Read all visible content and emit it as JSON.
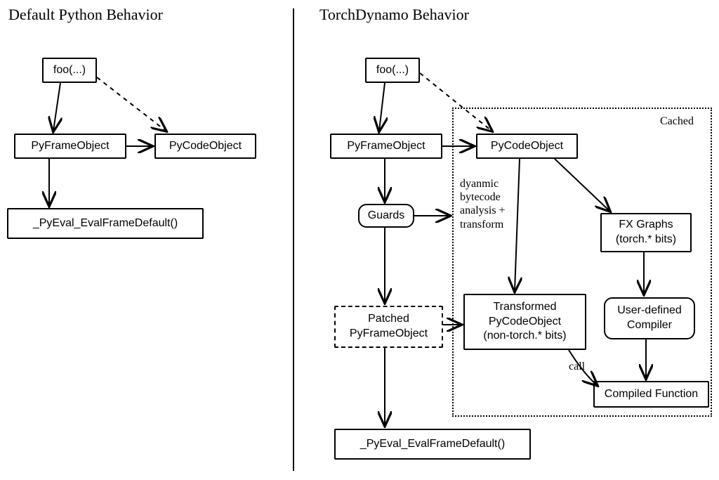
{
  "left": {
    "title": "Default Python Behavior",
    "foo": "foo(...)",
    "pyframe": "PyFrameObject",
    "pycode": "PyCodeObject",
    "eval": "_PyEval_EvalFrameDefault()"
  },
  "right": {
    "title": "TorchDynamo Behavior",
    "foo": "foo(...)",
    "pyframe": "PyFrameObject",
    "pycode": "PyCodeObject",
    "guards": "Guards",
    "patched": "Patched\nPyFrameObject",
    "transformed": "Transformed\nPyCodeObject\n(non-torch.* bits)",
    "fx": "FX Graphs\n(torch.* bits)",
    "udc": "User-defined\nCompiler",
    "compiled": "Compiled Function",
    "eval": "_PyEval_EvalFrameDefault()",
    "cached": "Cached",
    "dyn": "dyanmic\nbytecode\nanalysis +\ntransform",
    "call": "call"
  },
  "chart_data": {
    "type": "flowchart",
    "panels": [
      {
        "title": "Default Python Behavior",
        "nodes": [
          {
            "id": "foo",
            "label": "foo(...)"
          },
          {
            "id": "pyframe",
            "label": "PyFrameObject"
          },
          {
            "id": "pycode",
            "label": "PyCodeObject"
          },
          {
            "id": "eval",
            "label": "_PyEval_EvalFrameDefault()"
          }
        ],
        "edges": [
          {
            "from": "foo",
            "to": "pyframe",
            "style": "solid"
          },
          {
            "from": "foo",
            "to": "pycode",
            "style": "dashed"
          },
          {
            "from": "pyframe",
            "to": "pycode",
            "style": "solid"
          },
          {
            "from": "pyframe",
            "to": "eval",
            "style": "solid"
          }
        ]
      },
      {
        "title": "TorchDynamo Behavior",
        "cached_region": [
          "pycode",
          "transformed",
          "fx",
          "udc",
          "compiled"
        ],
        "nodes": [
          {
            "id": "foo",
            "label": "foo(...)"
          },
          {
            "id": "pyframe",
            "label": "PyFrameObject"
          },
          {
            "id": "pycode",
            "label": "PyCodeObject"
          },
          {
            "id": "guards",
            "label": "Guards",
            "shape": "rounded"
          },
          {
            "id": "patched",
            "label": "Patched PyFrameObject",
            "style": "dashed"
          },
          {
            "id": "transformed",
            "label": "Transformed PyCodeObject (non-torch.* bits)"
          },
          {
            "id": "fx",
            "label": "FX Graphs (torch.* bits)"
          },
          {
            "id": "udc",
            "label": "User-defined Compiler",
            "shape": "rounded"
          },
          {
            "id": "compiled",
            "label": "Compiled Function"
          },
          {
            "id": "eval",
            "label": "_PyEval_EvalFrameDefault()"
          }
        ],
        "edges": [
          {
            "from": "foo",
            "to": "pyframe",
            "style": "solid"
          },
          {
            "from": "foo",
            "to": "pycode",
            "style": "dashed"
          },
          {
            "from": "pyframe",
            "to": "pycode",
            "style": "solid"
          },
          {
            "from": "pyframe",
            "to": "guards",
            "style": "solid"
          },
          {
            "from": "guards",
            "to": "patched",
            "style": "solid"
          },
          {
            "from": "guards",
            "to": "transformed",
            "style": "solid",
            "note": "dyanmic bytecode analysis + transform"
          },
          {
            "from": "pycode",
            "to": "transformed",
            "style": "solid"
          },
          {
            "from": "pycode",
            "to": "fx",
            "style": "solid"
          },
          {
            "from": "fx",
            "to": "udc",
            "style": "solid"
          },
          {
            "from": "udc",
            "to": "compiled",
            "style": "solid"
          },
          {
            "from": "transformed",
            "to": "compiled",
            "style": "solid",
            "note": "call"
          },
          {
            "from": "patched",
            "to": "transformed",
            "style": "solid"
          },
          {
            "from": "patched",
            "to": "eval",
            "style": "solid"
          }
        ]
      }
    ]
  }
}
